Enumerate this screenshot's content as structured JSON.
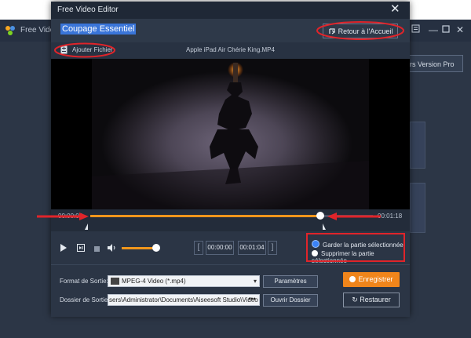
{
  "app": {
    "title": "Free Video"
  },
  "background": {
    "pro_button": "rs Version Pro"
  },
  "dialog": {
    "title": "Free Video Editor",
    "section_title": "Coupage Essentiel",
    "back_button": "Retour à l'Accueil",
    "add_file": "Ajouter Fichier",
    "file_name": "Apple iPad Air Chérie King.MP4"
  },
  "timeline": {
    "start_time": "00:00:04",
    "end_time": "00:01:18",
    "progress_fraction": 0.81
  },
  "controls": {
    "start_box": "00:00:00",
    "end_box": "00:01:04",
    "volume_fraction": 0.85,
    "keep_option": "Garder la partie sélectionnée",
    "delete_option": "Supprimer la partie sélectionnée",
    "selected_option": "keep"
  },
  "output": {
    "format_label": "Format de Sortie:",
    "format_value": "MPEG-4 Video (*.mp4)",
    "params_button": "Paramètres",
    "folder_label": "Dossier de Sortie:",
    "folder_value": "sers\\Administrator\\Documents\\Aiseesoft Studio\\Video",
    "open_folder_button": "Ouvrir Dossier",
    "save_button": "Enregistrer",
    "restore_button": "Restaurer"
  },
  "colors": {
    "accent": "#f0961c",
    "highlight": "#3a75d8",
    "annotation": "#e0242a",
    "radio_selected": "#3b82f6"
  },
  "icons": [
    "app-logo-icon",
    "back-arrow-icon",
    "add-file-icon",
    "play-icon",
    "frame-step-icon",
    "stop-icon",
    "volume-icon",
    "close-icon"
  ]
}
